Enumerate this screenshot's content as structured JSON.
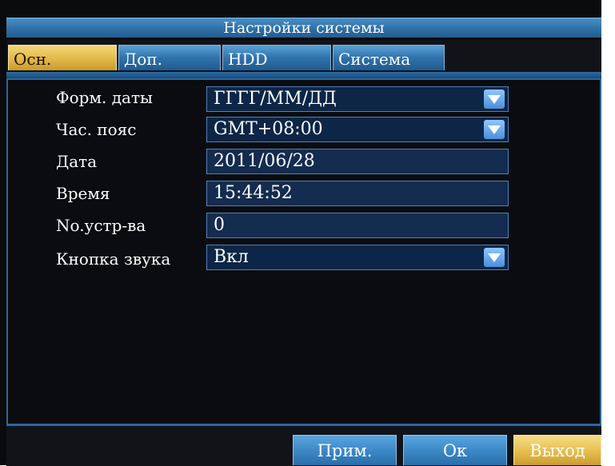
{
  "title": "Настройки системы",
  "tabs": [
    {
      "label": "Осн.",
      "active": true
    },
    {
      "label": "Доп.",
      "active": false
    },
    {
      "label": "HDD",
      "active": false
    },
    {
      "label": "Система",
      "active": false
    }
  ],
  "settings": {
    "date_format": {
      "label": "Форм. даты",
      "value": "ГГГГ/ММ/ДД"
    },
    "timezone": {
      "label": "Час. пояс",
      "value": "GMT+08:00"
    },
    "date": {
      "label": "Дата",
      "value": "2011/06/28"
    },
    "time": {
      "label": "Время",
      "value": "15:44:52"
    },
    "device_no": {
      "label": "No.устр-ва",
      "value": "0"
    },
    "key_sound": {
      "label": "Кнопка звука",
      "value": "Вкл"
    }
  },
  "buttons": {
    "apply": "Прим.",
    "ok": "Ок",
    "exit": "Выход"
  },
  "colors": {
    "accent_blue": "#3a86c4",
    "active_gold": "#e2b847",
    "background": "#0a0b0d"
  }
}
